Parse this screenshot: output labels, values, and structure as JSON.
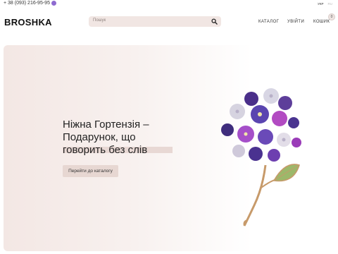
{
  "topbar": {
    "phone": "+ 38 (093) 216-95-95",
    "languages": [
      {
        "label": "УКР",
        "active": true
      },
      {
        "label": "RU",
        "active": false
      }
    ]
  },
  "header": {
    "logo": "BROSHKA",
    "search": {
      "placeholder": "Пошук"
    },
    "nav": {
      "catalog": "КАТАЛОГ",
      "login": "УВІЙТИ",
      "cart": "КОШИК"
    },
    "cart_count": "0"
  },
  "hero": {
    "title_line1": "Ніжна Гортензія –",
    "title_line2": "Подарунок, що",
    "title_line3": "говорить без слів",
    "button_label": "Перейти до каталогу"
  },
  "colors": {
    "accent": "#e7d7d2",
    "search_bg": "#f1e6e3",
    "viber": "#8e6bd0"
  }
}
